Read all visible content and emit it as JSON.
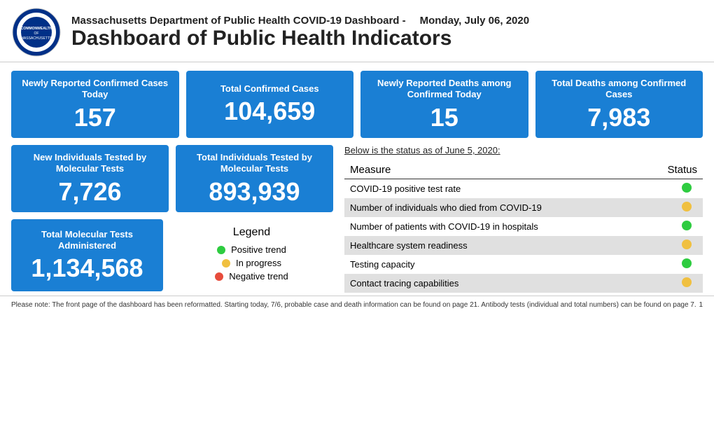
{
  "header": {
    "subtitle": "Massachusetts Department of Public Health COVID-19 Dashboard -",
    "date": "Monday, July 06, 2020",
    "title": "Dashboard of Public Health Indicators"
  },
  "metrics": {
    "row1": [
      {
        "label": "Newly Reported Confirmed Cases Today",
        "value": "157"
      },
      {
        "label": "Total Confirmed Cases",
        "value": "104,659"
      },
      {
        "label": "Newly Reported Deaths among Confirmed Today",
        "value": "15"
      },
      {
        "label": "Total Deaths among Confirmed Cases",
        "value": "7,983"
      }
    ],
    "row2": [
      {
        "label": "New Individuals Tested by Molecular Tests",
        "value": "7,726"
      },
      {
        "label": "Total Individuals Tested by Molecular Tests",
        "value": "893,939"
      }
    ],
    "row3": [
      {
        "label": "Total Molecular Tests Administered",
        "value": "1,134,568"
      }
    ]
  },
  "legend": {
    "title": "Legend",
    "items": [
      {
        "label": "Positive trend",
        "color": "green"
      },
      {
        "label": "In progress",
        "color": "yellow"
      },
      {
        "label": "Negative trend",
        "color": "red"
      }
    ]
  },
  "status_table": {
    "note": "Below is the status as of June 5, 2020:",
    "col_measure": "Measure",
    "col_status": "Status",
    "rows": [
      {
        "measure": "COVID-19 positive test rate",
        "status": "green"
      },
      {
        "measure": "Number of individuals who died from COVID-19",
        "status": "yellow"
      },
      {
        "measure": "Number of patients with COVID-19 in hospitals",
        "status": "green"
      },
      {
        "measure": "Healthcare system readiness",
        "status": "yellow"
      },
      {
        "measure": "Testing capacity",
        "status": "green"
      },
      {
        "measure": "Contact tracing capabilities",
        "status": "yellow"
      }
    ]
  },
  "footer": {
    "text": "Please note: The front page of the dashboard has been reformatted. Starting today, 7/6, probable case and death information can be found on page 21. Antibody tests (individual and total numbers) can be found on page 7.",
    "page": "1"
  }
}
